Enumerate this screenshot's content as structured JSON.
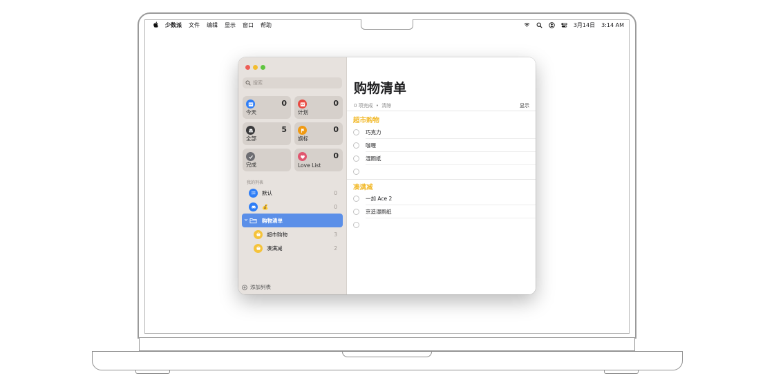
{
  "menubar": {
    "app": "少数派",
    "items": [
      "文件",
      "编辑",
      "显示",
      "窗口",
      "帮助"
    ],
    "date": "3月14日",
    "time": "3:14 AM"
  },
  "sidebar": {
    "search_placeholder": "搜索",
    "smart_lists": [
      {
        "label": "今天",
        "count": "0",
        "color": "#2f7ef6",
        "icon": "calendar-today-icon"
      },
      {
        "label": "计划",
        "count": "0",
        "color": "#e84a42",
        "icon": "calendar-scheduled-icon"
      },
      {
        "label": "全部",
        "count": "5",
        "color": "#3a3a3c",
        "icon": "tray-icon"
      },
      {
        "label": "旗标",
        "count": "0",
        "color": "#f09a12",
        "icon": "flag-icon"
      },
      {
        "label": "完成",
        "count": "",
        "color": "#6d6d72",
        "icon": "checkmark-icon"
      },
      {
        "label": "Love List",
        "count": "0",
        "color": "#e0566f",
        "icon": "heart-icon"
      }
    ],
    "section_label": "我的列表",
    "lists": [
      {
        "label": "默认",
        "count": "0",
        "color": "#2f7ef6",
        "icon": "list-bullet-icon"
      },
      {
        "label": "💰",
        "count": "0",
        "color": "#2f7ef6",
        "icon": "car-icon"
      }
    ],
    "group": {
      "label": "购物清单",
      "children": [
        {
          "label": "超市购物",
          "count": "3",
          "color": "#f5c33b",
          "icon": "basket-icon"
        },
        {
          "label": "凑满减",
          "count": "2",
          "color": "#f5c33b",
          "icon": "basket-icon"
        }
      ]
    },
    "add_list_label": "添加列表"
  },
  "main": {
    "title": "购物清单",
    "completed_text": "0 项完成",
    "dot": "•",
    "clear_label": "清除",
    "show_label": "显示",
    "accent_color": "#f2b92a",
    "sections": [
      {
        "title": "超市购物",
        "items": [
          "巧克力",
          "咖喱",
          "湿厕纸",
          ""
        ]
      },
      {
        "title": "凑满减",
        "items": [
          "一加 Ace 2",
          "京造湿厕纸",
          ""
        ]
      }
    ]
  }
}
